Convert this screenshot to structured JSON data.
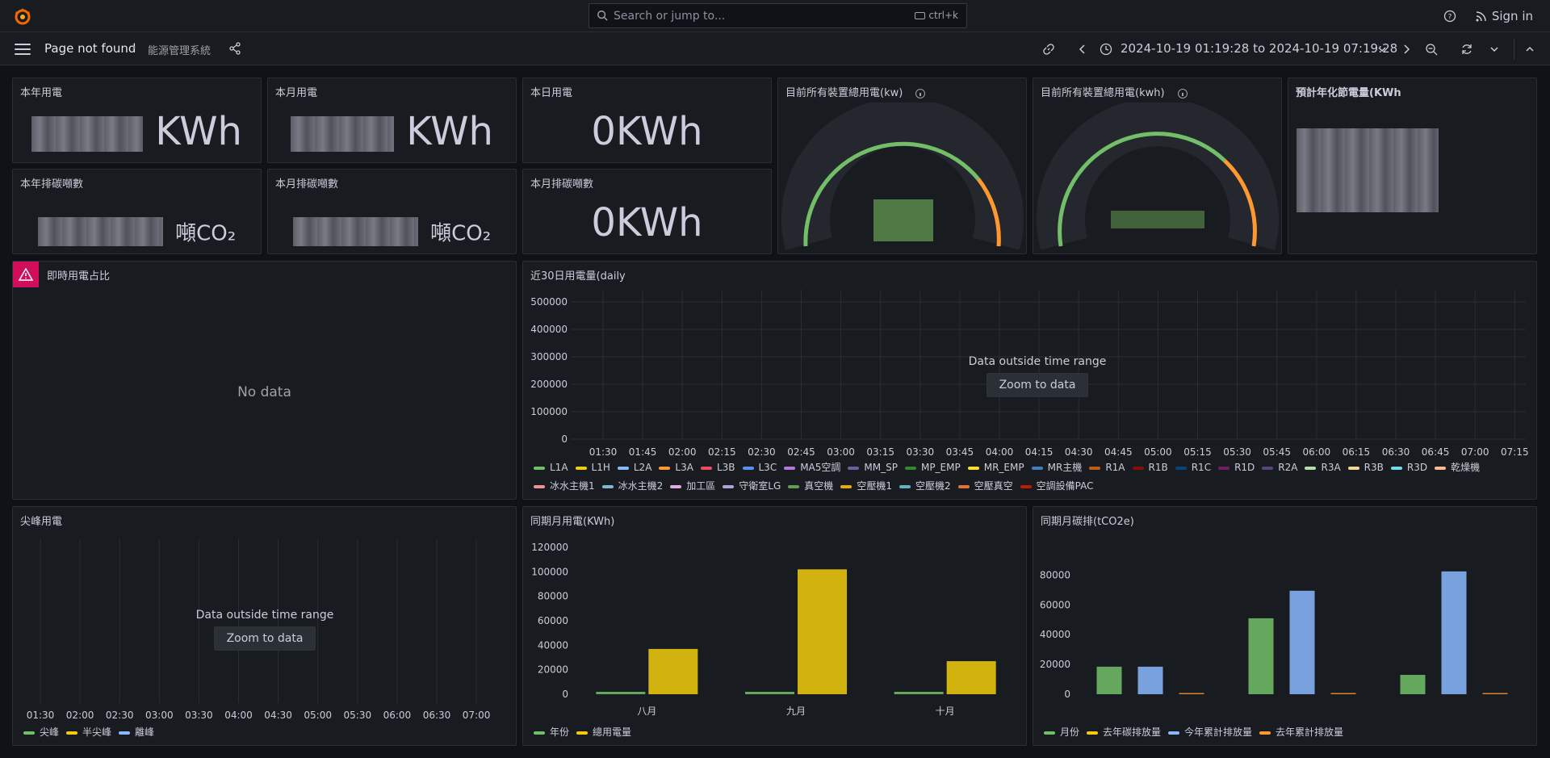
{
  "topbar": {
    "search_placeholder": "Search or jump to...",
    "search_shortcut": "ctrl+k",
    "sign_in": "Sign in"
  },
  "nav": {
    "breadcrumb_title": "Page not found",
    "breadcrumb_sep": "›",
    "breadcrumb_subtitle": "能源管理系統",
    "time_range": "2024-10-19 01:19:28 to 2024-10-19 07:19:28"
  },
  "stats": {
    "year_usage": {
      "title": "本年用電",
      "unit": "KWh"
    },
    "month_usage": {
      "title": "本月用電",
      "unit": "KWh"
    },
    "day_usage": {
      "title": "本日用電",
      "value": "0KWh"
    },
    "year_carbon": {
      "title": "本年排碳噸數",
      "unit": "噸CO₂"
    },
    "month_carbon": {
      "title": "本月排碳噸數",
      "unit": "噸CO₂"
    },
    "month_carbon2": {
      "title": "本月排碳噸數",
      "value": "0KWh"
    },
    "gauge_kw": {
      "title": "目前所有裝置總用電(kw)"
    },
    "gauge_kwh": {
      "title": "目前所有裝置總用電(kwh)"
    },
    "annual_saving": {
      "title": "預計年化節電量(KWh"
    }
  },
  "realtime": {
    "title": "即時用電占比",
    "nodata": "No data"
  },
  "daily": {
    "title": "近30日用電量(daily",
    "out_of_range": "Data outside time range",
    "zoom": "Zoom to data",
    "yticks": [
      "500000",
      "400000",
      "300000",
      "200000",
      "100000",
      "0"
    ],
    "xticks": [
      "01:30",
      "01:45",
      "02:00",
      "02:15",
      "02:30",
      "02:45",
      "03:00",
      "03:15",
      "03:30",
      "03:45",
      "04:00",
      "04:15",
      "04:30",
      "04:45",
      "05:00",
      "05:15",
      "05:30",
      "05:45",
      "06:00",
      "06:15",
      "06:30",
      "06:45",
      "07:00",
      "07:15"
    ],
    "legend_row1": [
      {
        "name": "L1A",
        "color": "#73bf69"
      },
      {
        "name": "L1H",
        "color": "#f2cc0c"
      },
      {
        "name": "L2A",
        "color": "#8ab8ff"
      },
      {
        "name": "L3A",
        "color": "#ff9830"
      },
      {
        "name": "L3B",
        "color": "#f2495c"
      },
      {
        "name": "L3C",
        "color": "#5794f2"
      },
      {
        "name": "MA5空調",
        "color": "#b877d9"
      },
      {
        "name": "MM_SP",
        "color": "#705da0"
      },
      {
        "name": "MP_EMP",
        "color": "#37872d"
      },
      {
        "name": "MR_EMP",
        "color": "#fade2a"
      },
      {
        "name": "MR主機",
        "color": "#447ebc"
      },
      {
        "name": "R1A",
        "color": "#c15c17"
      },
      {
        "name": "R1B",
        "color": "#890f02"
      },
      {
        "name": "R1C",
        "color": "#0a437c"
      },
      {
        "name": "R1D",
        "color": "#6d1f62"
      },
      {
        "name": "R2A",
        "color": "#584477"
      },
      {
        "name": "R3A",
        "color": "#b7dbab"
      },
      {
        "name": "R3B",
        "color": "#f4d598"
      },
      {
        "name": "R3D",
        "color": "#70dbed"
      },
      {
        "name": "乾燥機",
        "color": "#f9ba8f"
      }
    ],
    "legend_row2": [
      {
        "name": "冰水主機1",
        "color": "#f29191"
      },
      {
        "name": "冰水主機2",
        "color": "#82b5d8"
      },
      {
        "name": "加工區",
        "color": "#e5a8e2"
      },
      {
        "name": "守衛室LG",
        "color": "#aea2e0"
      },
      {
        "name": "真空機",
        "color": "#629e51"
      },
      {
        "name": "空壓機1",
        "color": "#e5ac0e"
      },
      {
        "name": "空壓機2",
        "color": "#64b0c8"
      },
      {
        "name": "空壓真空",
        "color": "#e0752d"
      },
      {
        "name": "空調設備PAC",
        "color": "#bf1b00"
      }
    ]
  },
  "peak": {
    "title": "尖峰用電",
    "out_of_range": "Data outside time range",
    "zoom": "Zoom to data",
    "xticks": [
      "01:30",
      "02:00",
      "02:30",
      "03:00",
      "03:30",
      "04:00",
      "04:30",
      "05:00",
      "05:30",
      "06:00",
      "06:30",
      "07:00"
    ],
    "legend": [
      {
        "name": "尖峰",
        "color": "#73bf69"
      },
      {
        "name": "半尖峰",
        "color": "#f2cc0c"
      },
      {
        "name": "離峰",
        "color": "#8ab8ff"
      }
    ]
  },
  "charts": {
    "monthly_usage": {
      "title": "同期月用電(KWh)"
    },
    "monthly_carbon": {
      "title": "同期月碳排(tCO2e)"
    }
  },
  "chart_data": [
    {
      "type": "bar",
      "title": "同期月用電(KWh)",
      "categories": [
        "八月",
        "九月",
        "十月"
      ],
      "series": [
        {
          "name": "年份",
          "color": "#73bf69",
          "values": [
            2024,
            2024,
            2024
          ]
        },
        {
          "name": "總用電量",
          "color": "#f2cc0c",
          "values": [
            37000,
            102000,
            27000
          ]
        }
      ],
      "yticks": [
        0,
        20000,
        40000,
        60000,
        80000,
        100000,
        120000
      ],
      "ylim": [
        0,
        120000
      ]
    },
    {
      "type": "bar",
      "title": "同期月碳排(tCO2e)",
      "categories": [
        "",
        "",
        ""
      ],
      "series": [
        {
          "name": "月份",
          "color": "#73bf69",
          "values": [
            18500,
            51000,
            13000
          ]
        },
        {
          "name": "去年碳排放量",
          "color": "#f2cc0c",
          "values": [
            0,
            0,
            0
          ]
        },
        {
          "name": "今年累計排放量",
          "color": "#8ab8ff",
          "values": [
            18500,
            69500,
            82500
          ]
        },
        {
          "name": "去年累計排放量",
          "color": "#ff9830",
          "values": [
            300,
            300,
            300
          ]
        }
      ],
      "yticks": [
        0,
        20000,
        40000,
        60000,
        80000
      ],
      "ylim": [
        0,
        90000
      ]
    }
  ]
}
